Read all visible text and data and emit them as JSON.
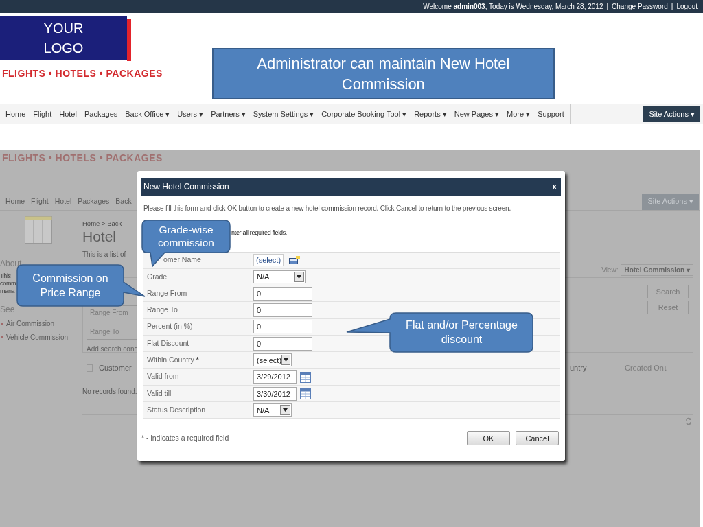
{
  "top_bar": {
    "welcome": "Welcome **admin003**, Today is Wednesday, March 28, 2012",
    "links": [
      {
        "separator": "|",
        "label": "Change Password"
      },
      {
        "separator": "|",
        "label": "Logout"
      }
    ]
  },
  "logo": {
    "lines": [
      "YOUR",
      "LOGO"
    ],
    "tagline": "FLIGHTS • HOTELS • PACKAGES"
  },
  "slide_title": "Administrator can maintain New Hotel Commission",
  "nav": {
    "items": [
      "Home",
      "Flight",
      "Hotel",
      "Packages",
      "Back Office ▾",
      "Users ▾",
      "Partners ▾",
      "System Settings ▾",
      "Corporate Booking Tool ▾",
      "Reports ▾",
      "New Pages ▾",
      "More ▾",
      "Support"
    ],
    "site_actions": "Site Actions ▾"
  },
  "background_page": {
    "tagline": "FLIGHTS • HOTELS • PACKAGES",
    "nav_items": [
      "Home",
      "Flight",
      "Hotel",
      "Packages",
      "Back"
    ],
    "site_actions": "Site Actions ▾",
    "about_heading": "About",
    "about_lines": [
      "This",
      "comm",
      "mana"
    ],
    "see_also": "See",
    "links": [
      "Air Commission",
      "Vehicle Commission"
    ],
    "breadcrumb": "Home > Back",
    "page_title": "Hotel",
    "intro": "This is a list of",
    "view_label": "View:",
    "view_value": "Hotel Commission ▾",
    "search_fields": [
      "Range From",
      "Range To"
    ],
    "add_condition": "Add search cond",
    "buttons": [
      "Search",
      "Reset"
    ],
    "select_all_checked": false,
    "columns": [
      "Customer",
      "untry",
      "Created On↓"
    ],
    "empty_message": "No records found."
  },
  "dialog": {
    "title": "New Hotel Commission",
    "close": "x",
    "description": "Please fill this form and click OK button to create a new hotel commission record. Click Cancel to return to the previous screen.",
    "hint": "nter all required fields.",
    "rows": [
      {
        "label": "omer Name",
        "kind": "link",
        "value": "(select)"
      },
      {
        "label": "Grade",
        "kind": "dropdown",
        "value": "N/A"
      },
      {
        "label": "Range From",
        "kind": "text",
        "value": "0"
      },
      {
        "label": "Range To",
        "kind": "text",
        "value": "0"
      },
      {
        "label": "Percent (in %)",
        "kind": "text",
        "value": "0"
      },
      {
        "label": "Flat Discount",
        "kind": "text",
        "value": "0"
      },
      {
        "label": "Within Country",
        "required_mark": "*",
        "kind": "dropdown_small",
        "value": "(select)"
      },
      {
        "label": "Valid from",
        "kind": "date",
        "value": "3/29/2012"
      },
      {
        "label": "Valid till",
        "kind": "date",
        "value": "3/30/2012"
      },
      {
        "label": "Status Description",
        "kind": "dropdown_small",
        "value": "N/A"
      }
    ],
    "footnote": "* - indicates a required field",
    "buttons": [
      "OK",
      "Cancel"
    ]
  },
  "callouts": [
    {
      "kind": "pointer_down",
      "text": "Grade-wise commission"
    },
    {
      "kind": "pointer_right",
      "text": "Commission on Price Range"
    },
    {
      "kind": "pointer_left",
      "text": "Flat and/or Percentage discount"
    }
  ]
}
